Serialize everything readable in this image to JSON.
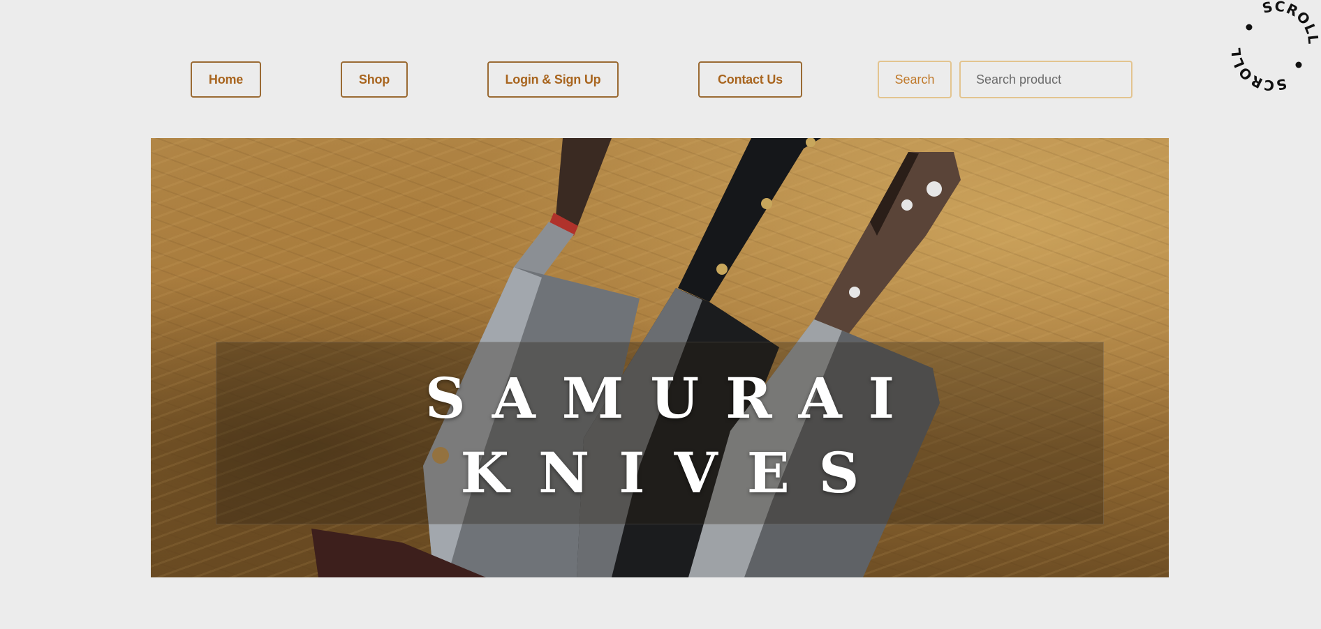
{
  "nav": {
    "items": [
      {
        "label": "Home"
      },
      {
        "label": "Shop"
      },
      {
        "label": "Login & Sign Up"
      },
      {
        "label": "Contact Us"
      }
    ],
    "search_button_label": "Search",
    "search_placeholder": "Search product"
  },
  "scroll_badge": {
    "top_text": "SCROLL",
    "bottom_text": "SCROLL"
  },
  "hero": {
    "title_line_1": "SAMURAI",
    "title_line_2": "KNIVES"
  },
  "colors": {
    "background": "#ececec",
    "accent": "#a8651f",
    "border": "#9a6a33",
    "search_border": "#e3c48f"
  }
}
